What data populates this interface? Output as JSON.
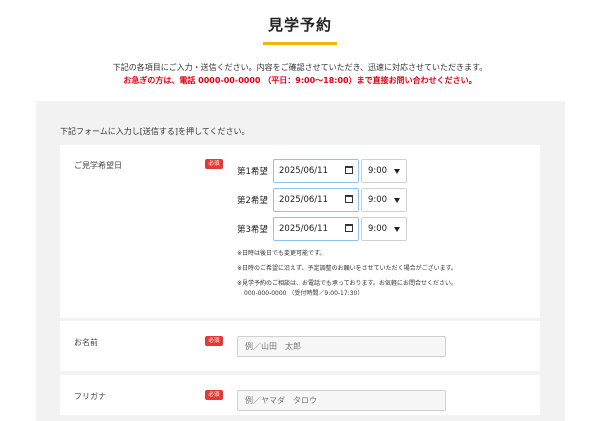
{
  "page": {
    "title": "見学予約",
    "intro_line": "下記の各項目にご入力・送信ください。内容をご確認させていただき、迅速に対応させていただきます。",
    "alert_line": "お急ぎの方は、電話 0000-00-0000 （平日：9:00～18:00）まで直接お問い合わせください。",
    "accent_color": "#f3b700",
    "alert_color": "#e60012"
  },
  "form": {
    "lead": "下記フォームに入力し[送信する]を押してください。",
    "required_badge": "必須",
    "visit_date": {
      "label": "ご見学希望日",
      "preferences": [
        {
          "label": "第1希望",
          "date": "2025/06/11",
          "time": "9:00"
        },
        {
          "label": "第2希望",
          "date": "2025/06/11",
          "time": "9:00"
        },
        {
          "label": "第3希望",
          "date": "2025/06/11",
          "time": "9:00"
        }
      ],
      "notes": [
        "※日時は後日でも変更可能です。",
        "※日時のご希望に沿えず、予定調整のお願いをさせていただく場合がございます。",
        "※見学予約のご相談は、お電話でも承っております。お気軽にお問合せください。"
      ],
      "contact_note": "000-000-0000 （受付時間／9:00-17:30）"
    },
    "name": {
      "label": "お名前",
      "placeholder": "例／山田　太郎"
    },
    "kana": {
      "label": "フリガナ",
      "placeholder": "例／ヤマダ　タロウ"
    }
  }
}
